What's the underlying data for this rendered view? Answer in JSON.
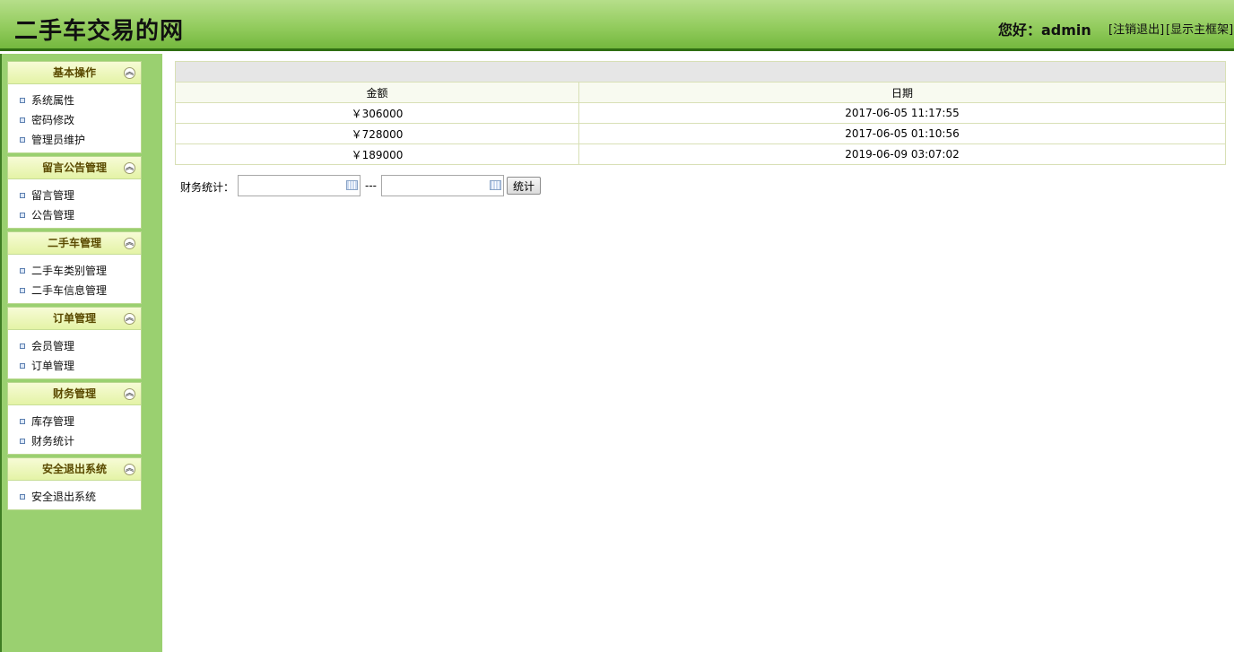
{
  "header": {
    "site_title": "二手车交易的网",
    "greeting": "您好：admin",
    "logout_link": "[注销退出]",
    "show_frame_link": "[显示主框架]"
  },
  "sidebar": {
    "groups": [
      {
        "title": "基本操作",
        "items": [
          "系统属性",
          "密码修改",
          "管理员维护"
        ]
      },
      {
        "title": "留言公告管理",
        "items": [
          "留言管理",
          "公告管理"
        ]
      },
      {
        "title": "二手车管理",
        "items": [
          "二手车类别管理",
          "二手车信息管理"
        ]
      },
      {
        "title": "订单管理",
        "items": [
          "会员管理",
          "订单管理"
        ]
      },
      {
        "title": "财务管理",
        "items": [
          "库存管理",
          "财务统计"
        ]
      },
      {
        "title": "安全退出系统",
        "items": [
          "安全退出系统"
        ]
      }
    ]
  },
  "table": {
    "columns": [
      "金额",
      "日期"
    ],
    "rows": [
      [
        "￥306000",
        "2017-06-05 11:17:55"
      ],
      [
        "￥728000",
        "2017-06-05 01:10:56"
      ],
      [
        "￥189000",
        "2019-06-09 03:07:02"
      ]
    ]
  },
  "stats": {
    "label": "财务统计：",
    "separator": "---",
    "start_value": "",
    "end_value": "",
    "button_label": "统计"
  },
  "icons": {
    "collapse": "collapse-up-icon",
    "calendar": "calendar-icon",
    "bullet": "bullet-icon"
  }
}
